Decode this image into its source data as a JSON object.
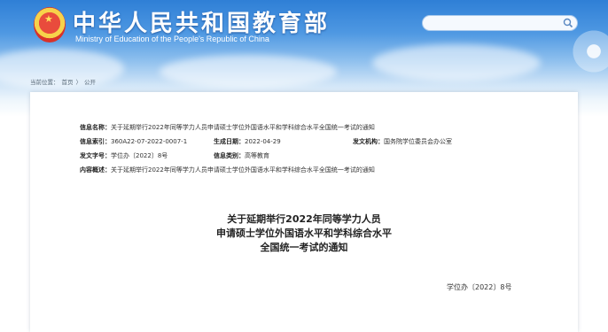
{
  "header": {
    "title_cn": "中华人民共和国教育部",
    "title_en": "Ministry of Education of the People's Republic of China",
    "search_placeholder": ""
  },
  "breadcrumb": {
    "prefix": "当前位置：",
    "home": "首页",
    "separator": "〉",
    "current": "公开"
  },
  "meta": {
    "name_label": "信息名称：",
    "name_value": "关于延期举行2022年同等学力人员申请硕士学位外国语水平和学科综合水平全国统一考试的通知",
    "index_label": "信息索引：",
    "index_value": "360A22-07-2022-0007-1",
    "date_label": "生成日期：",
    "date_value": "2022-04-29",
    "org_label": "发文机构：",
    "org_value": "国务院学位委员会办公室",
    "docnum_label": "发文字号：",
    "docnum_value": "学位办〔2022〕8号",
    "category_label": "信息类别：",
    "category_value": "高等教育",
    "summary_label": "内容概述：",
    "summary_value": "关于延期举行2022年同等学力人员申请硕士学位外国语水平和学科综合水平全国统一考试的通知"
  },
  "document": {
    "title_line1": "关于延期举行2022年同等学力人员",
    "title_line2": "申请硕士学位外国语水平和学科综合水平",
    "title_line3": "全国统一考试的通知",
    "doc_number": "学位办〔2022〕8号"
  },
  "colors": {
    "header_blue": "#2f7fd6",
    "text": "#333333"
  }
}
